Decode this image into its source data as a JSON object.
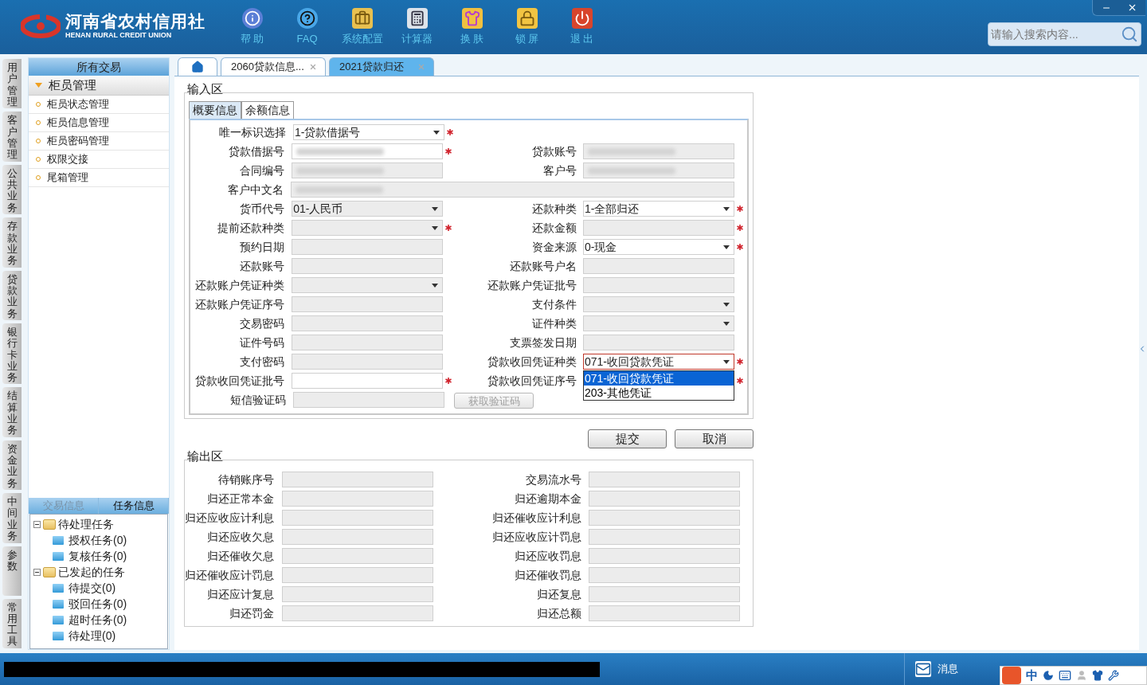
{
  "header": {
    "logo": {
      "name_cn": "河南省农村信用社",
      "name_en": "HENAN RURAL CREDIT UNION"
    },
    "toolbar": [
      {
        "label": "帮 助"
      },
      {
        "label": "FAQ"
      },
      {
        "label": "系统配置"
      },
      {
        "label": "计算器"
      },
      {
        "label": "换 肤"
      },
      {
        "label": "锁 屏"
      },
      {
        "label": "退 出"
      }
    ],
    "search": {
      "placeholder": "请输入搜索内容..."
    }
  },
  "vertical_tabs": [
    "用户管理",
    "客户管理",
    "公共业务",
    "存款业务",
    "贷款业务",
    "银行卡业务",
    "结算业务",
    "资金业务",
    "中间业务",
    "参数",
    "常用工具"
  ],
  "sidebar": {
    "title": "所有交易",
    "group": {
      "label": "柜员管理",
      "expanded": true
    },
    "items": [
      "柜员状态管理",
      "柜员信息管理",
      "柜员密码管理",
      "权限交接",
      "尾箱管理"
    ],
    "bottom_tabs": [
      {
        "label": "交易信息",
        "selected": false
      },
      {
        "label": "任务信息",
        "selected": true
      }
    ],
    "tree": [
      {
        "label": "待处理任务",
        "expanded": true,
        "children": [
          {
            "label": "授权任务(0)"
          },
          {
            "label": "复核任务(0)"
          }
        ]
      },
      {
        "label": "已发起的任务",
        "expanded": true,
        "children": [
          {
            "label": "待提交(0)"
          },
          {
            "label": "驳回任务(0)"
          },
          {
            "label": "超时任务(0)"
          },
          {
            "label": "待处理(0)"
          }
        ]
      }
    ]
  },
  "tabs": [
    {
      "kind": "home",
      "selected": false
    },
    {
      "kind": "page",
      "label": "2060贷款信息...",
      "selected": false
    },
    {
      "kind": "page",
      "label": "2021贷款归还",
      "selected": true
    }
  ],
  "input_area": {
    "title": "输入区",
    "tabs": [
      {
        "label": "概要信息",
        "selected": true
      },
      {
        "label": "余额信息",
        "selected": false
      }
    ],
    "rows": [
      {
        "left": {
          "label": "唯一标识选择",
          "kind": "select",
          "value": "1-贷款借据号",
          "required": true,
          "editable": true
        }
      },
      {
        "left": {
          "label": "贷款借据号",
          "kind": "text",
          "required": true,
          "editable": true,
          "redacted": true
        },
        "right": {
          "label": "贷款账号",
          "kind": "text",
          "redacted": true
        }
      },
      {
        "left": {
          "label": "合同编号",
          "kind": "text",
          "redacted": true
        },
        "right": {
          "label": "客户号",
          "kind": "text",
          "redacted": true
        }
      },
      {
        "wide": {
          "label": "客户中文名",
          "kind": "text",
          "redacted": true
        }
      },
      {
        "left": {
          "label": "货币代号",
          "kind": "select",
          "value": "01-人民币"
        },
        "right": {
          "label": "还款种类",
          "kind": "select",
          "value": "1-全部归还",
          "required": true,
          "editable": true
        }
      },
      {
        "left": {
          "label": "提前还款种类",
          "kind": "select",
          "required": true
        },
        "right": {
          "label": "还款金额",
          "kind": "text",
          "required": true
        }
      },
      {
        "left": {
          "label": "预约日期",
          "kind": "text"
        },
        "right": {
          "label": "资金来源",
          "kind": "select",
          "value": "0-现金",
          "required": true,
          "editable": true
        }
      },
      {
        "left": {
          "label": "还款账号",
          "kind": "text"
        },
        "right": {
          "label": "还款账号户名",
          "kind": "text"
        }
      },
      {
        "left": {
          "label": "还款账户凭证种类",
          "kind": "select"
        },
        "right": {
          "label": "还款账户凭证批号",
          "kind": "text"
        }
      },
      {
        "left": {
          "label": "还款账户凭证序号",
          "kind": "text"
        },
        "right": {
          "label": "支付条件",
          "kind": "select"
        }
      },
      {
        "left": {
          "label": "交易密码",
          "kind": "text"
        },
        "right": {
          "label": "证件种类",
          "kind": "select"
        }
      },
      {
        "left": {
          "label": "证件号码",
          "kind": "text"
        },
        "right": {
          "label": "支票签发日期",
          "kind": "text"
        }
      },
      {
        "left": {
          "label": "支付密码",
          "kind": "text"
        },
        "right": {
          "label": "贷款收回凭证种类",
          "kind": "select",
          "value": "071-收回贷款凭证",
          "required": true,
          "editable": true,
          "focused": true,
          "options": [
            {
              "label": "071-收回贷款凭证",
              "selected": true
            },
            {
              "label": "203-其他凭证",
              "selected": false
            }
          ]
        }
      },
      {
        "left": {
          "label": "贷款收回凭证批号",
          "kind": "text",
          "required": true,
          "editable": true
        },
        "right": {
          "label": "贷款收回凭证序号",
          "kind": "text",
          "required": true
        }
      },
      {
        "left": {
          "label": "短信验证码",
          "kind": "text"
        },
        "button": {
          "label": "获取验证码",
          "disabled": true
        }
      }
    ]
  },
  "actions": [
    "提交",
    "取消"
  ],
  "output_area": {
    "title": "输出区",
    "rows": [
      [
        "待销账序号",
        "交易流水号"
      ],
      [
        "归还正常本金",
        "归还逾期本金"
      ],
      [
        "归还应收应计利息",
        "归还催收应计利息"
      ],
      [
        "归还应收欠息",
        "归还应收应计罚息"
      ],
      [
        "归还催收欠息",
        "归还应收罚息"
      ],
      [
        "归还催收应计罚息",
        "归还催收罚息"
      ],
      [
        "归还应计复息",
        "归还复息"
      ],
      [
        "归还罚金",
        "归还总额"
      ]
    ]
  },
  "status_bar": {
    "items": [
      {
        "label": "消息"
      }
    ],
    "ime": {
      "label": "中"
    }
  }
}
